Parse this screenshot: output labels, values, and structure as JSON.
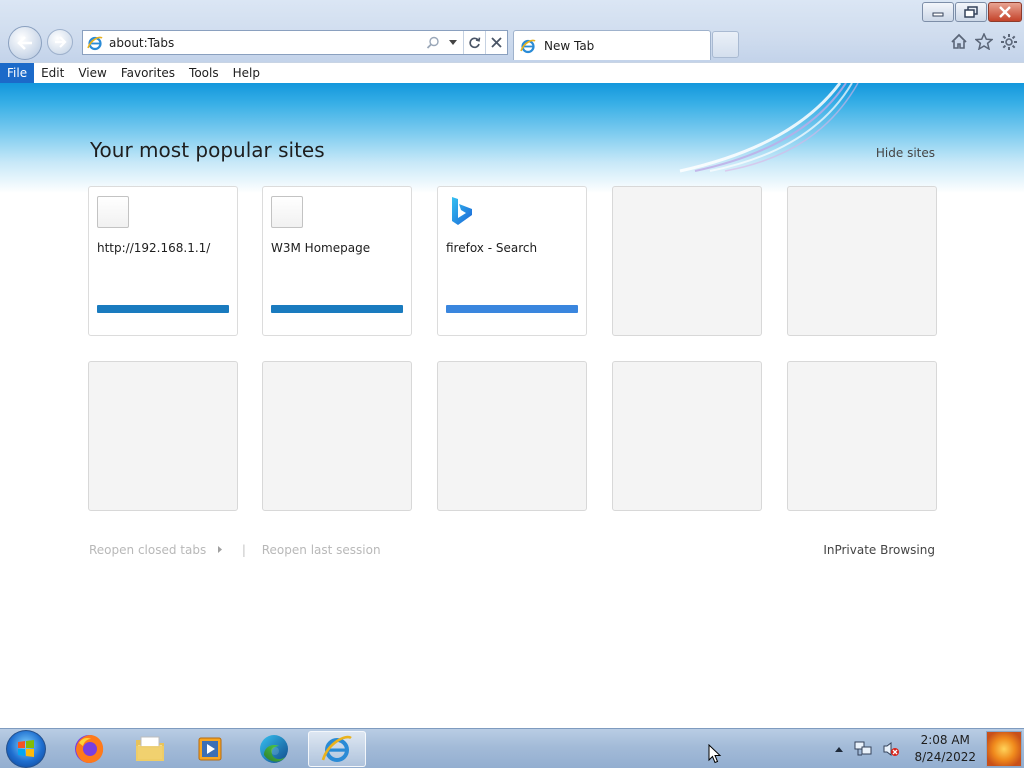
{
  "window_controls": {
    "minimize": "minimize-icon",
    "restore": "restore-icon",
    "close": "close-icon"
  },
  "navigation": {
    "back": "back-arrow-icon",
    "forward": "forward-arrow-icon"
  },
  "address_bar": {
    "url": "about:Tabs",
    "tools": [
      "search-icon",
      "dropdown-icon",
      "refresh-icon",
      "stop-icon"
    ]
  },
  "tabs": [
    {
      "label": "New Tab",
      "active": true
    }
  ],
  "toolbar_right": [
    "home-icon",
    "favorites-star-icon",
    "settings-gear-icon"
  ],
  "menu": {
    "items": [
      {
        "label": "File",
        "active": true
      },
      {
        "label": "Edit"
      },
      {
        "label": "View"
      },
      {
        "label": "Favorites"
      },
      {
        "label": "Tools"
      },
      {
        "label": "Help"
      }
    ]
  },
  "page": {
    "title": "Your most popular sites",
    "hide_sites": "Hide sites",
    "tiles": [
      {
        "title": "http://192.168.1.1/",
        "icon": "blank-page-icon",
        "bar_color": "#1a7bbf"
      },
      {
        "title": "W3M Homepage",
        "icon": "blank-page-icon",
        "bar_color": "#1a7bbf"
      },
      {
        "title": "firefox - Search",
        "icon": "bing-logo-icon",
        "bar_color": "#3a86de"
      },
      {
        "title": "",
        "empty": true
      },
      {
        "title": "",
        "empty": true
      },
      {
        "title": "",
        "empty": true
      },
      {
        "title": "",
        "empty": true
      },
      {
        "title": "",
        "empty": true
      },
      {
        "title": "",
        "empty": true
      },
      {
        "title": "",
        "empty": true
      }
    ],
    "reopen_closed_tabs": "Reopen closed tabs",
    "separator": "|",
    "reopen_last_session": "Reopen last session",
    "inprivate": "InPrivate Browsing"
  },
  "taskbar": {
    "start": "windows-start-icon",
    "apps": [
      "firefox-icon",
      "file-explorer-icon",
      "media-player-icon",
      "edge-icon",
      "internet-explorer-icon"
    ],
    "active_app": "internet-explorer-icon",
    "tray": [
      "show-hidden-icons-icon",
      "network-icon",
      "volume-muted-icon"
    ],
    "time": "2:08 AM",
    "date": "8/24/2022"
  }
}
